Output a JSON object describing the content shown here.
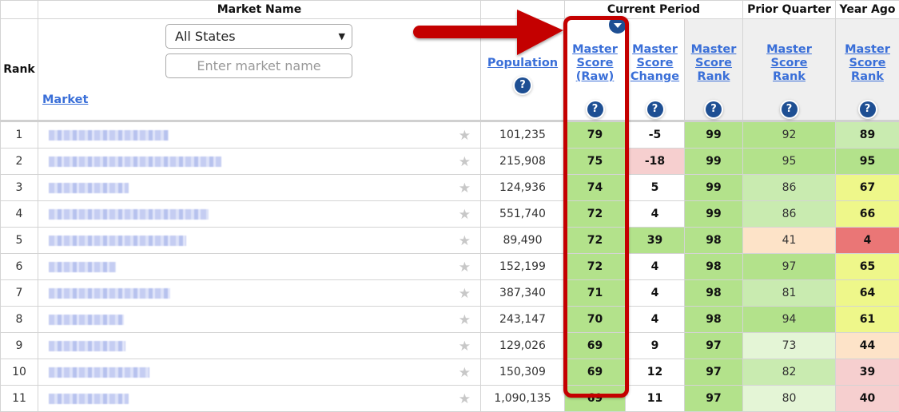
{
  "group_headers": {
    "market_name": "Market Name",
    "current_period": "Current Period",
    "prior_quarter": "Prior Quarter",
    "year_ago": "Year Ago"
  },
  "columns": {
    "rank": "Rank",
    "market": "Market",
    "population": "Population",
    "master_score_raw": [
      "Master",
      "Score",
      "(Raw)"
    ],
    "master_score_change": [
      "Master",
      "Score",
      "Change"
    ],
    "master_score_rank": [
      "Master",
      "Score",
      "Rank"
    ],
    "prior_master_score_rank": [
      "Master",
      "Score",
      "Rank"
    ],
    "year_master_score_rank": [
      "Master",
      "Score",
      "Rank"
    ]
  },
  "filters": {
    "state_select": "All States",
    "market_input_placeholder": "Enter market name"
  },
  "icons": {
    "help": "?",
    "star": "★",
    "select_chevron": "⌄"
  },
  "sort": {
    "column": "master_score_raw",
    "direction": "descending"
  },
  "annotation": {
    "arrow_color": "#c40000",
    "highlight_color": "#c40000",
    "highlighted_column": "master_score_raw"
  },
  "rows": [
    {
      "rank": "1",
      "market": "[redacted]",
      "population": "101,235",
      "raw": "79",
      "change": "-5",
      "rank_now": "99",
      "prior": "92",
      "year": "89"
    },
    {
      "rank": "2",
      "market": "[redacted]",
      "population": "215,908",
      "raw": "75",
      "change": "-18",
      "rank_now": "99",
      "prior": "95",
      "year": "95"
    },
    {
      "rank": "3",
      "market": "[redacted]",
      "population": "124,936",
      "raw": "74",
      "change": "5",
      "rank_now": "99",
      "prior": "86",
      "year": "67"
    },
    {
      "rank": "4",
      "market": "[redacted]",
      "population": "551,740",
      "raw": "72",
      "change": "4",
      "rank_now": "99",
      "prior": "86",
      "year": "66"
    },
    {
      "rank": "5",
      "market": "[redacted]",
      "population": "89,490",
      "raw": "72",
      "change": "39",
      "rank_now": "98",
      "prior": "41",
      "year": "4"
    },
    {
      "rank": "6",
      "market": "[redacted]",
      "population": "152,199",
      "raw": "72",
      "change": "4",
      "rank_now": "98",
      "prior": "97",
      "year": "65"
    },
    {
      "rank": "7",
      "market": "[redacted]",
      "population": "387,340",
      "raw": "71",
      "change": "4",
      "rank_now": "98",
      "prior": "81",
      "year": "64"
    },
    {
      "rank": "8",
      "market": "[redacted]",
      "population": "243,147",
      "raw": "70",
      "change": "4",
      "rank_now": "98",
      "prior": "94",
      "year": "61"
    },
    {
      "rank": "9",
      "market": "[redacted]",
      "population": "129,026",
      "raw": "69",
      "change": "9",
      "rank_now": "97",
      "prior": "73",
      "year": "44"
    },
    {
      "rank": "10",
      "market": "[redacted]",
      "population": "150,309",
      "raw": "69",
      "change": "12",
      "rank_now": "97",
      "prior": "82",
      "year": "39"
    },
    {
      "rank": "11",
      "market": "[redacted]",
      "population": "1,090,135",
      "raw": "69",
      "change": "11",
      "rank_now": "97",
      "prior": "80",
      "year": "40"
    }
  ]
}
